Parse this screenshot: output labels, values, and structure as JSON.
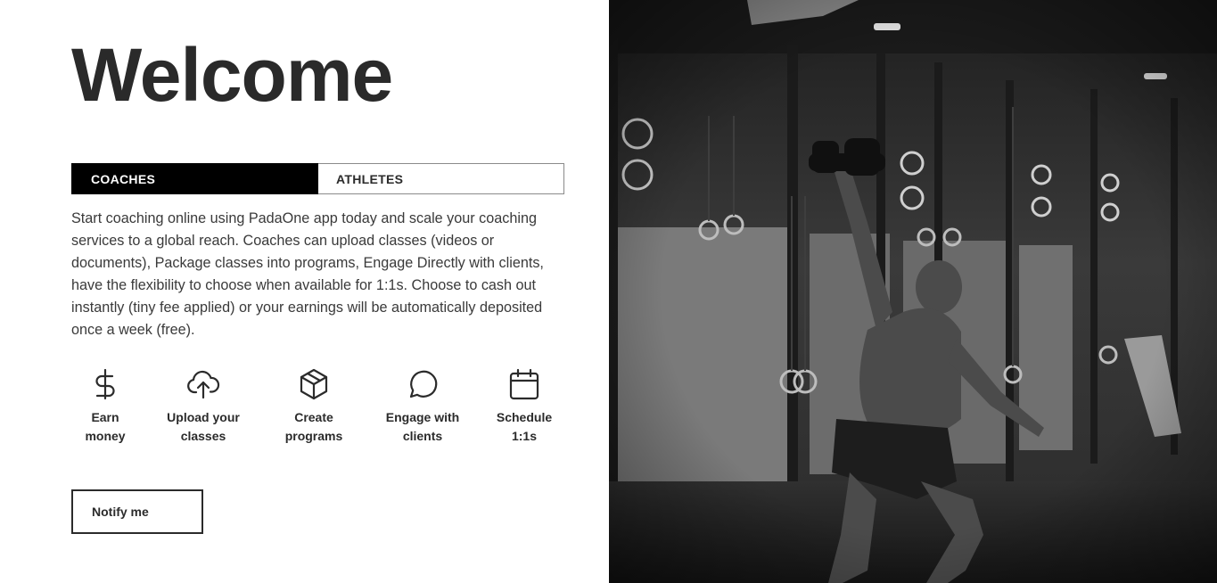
{
  "welcome": {
    "title": "Welcome"
  },
  "tabs": [
    {
      "label": "COACHES",
      "active": true
    },
    {
      "label": "ATHLETES",
      "active": false
    }
  ],
  "description": "Start coaching online using PadaOne app today and scale your coaching services to a global reach. Coaches can upload classes (videos or documents), Package classes into programs, Engage Directly with clients, have the flexibility to choose when available for 1:1s. Choose to cash out instantly (tiny fee applied) or your earnings will be automatically deposited once a week (free).",
  "features": [
    {
      "line1": "Earn",
      "line2": "money",
      "icon": "dollar-icon"
    },
    {
      "line1": "Upload your",
      "line2": "classes",
      "icon": "upload-cloud-icon"
    },
    {
      "line1": "Create",
      "line2": "programs",
      "icon": "package-box-icon"
    },
    {
      "line1": "Engage with",
      "line2": "clients",
      "icon": "chat-bubble-icon"
    },
    {
      "line1": "Schedule",
      "line2": "1:1s",
      "icon": "calendar-icon"
    }
  ],
  "notify": {
    "label": "Notify me"
  },
  "hero_image": {
    "subject": "athlete-kettlebell-photo",
    "tone": "grayscale"
  }
}
